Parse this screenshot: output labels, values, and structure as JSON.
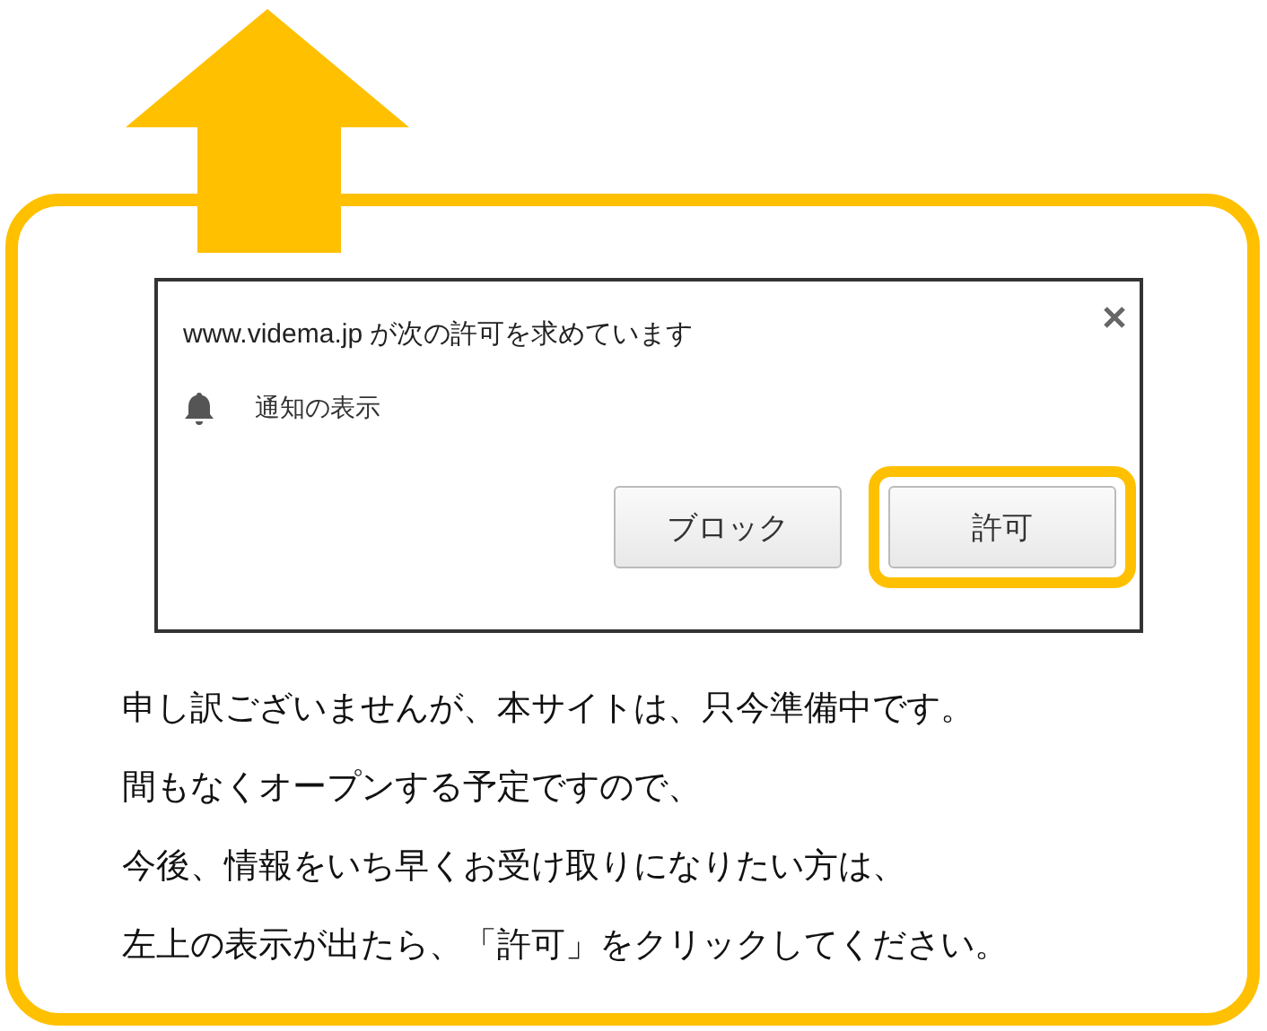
{
  "dialog": {
    "title": "www.videma.jp が次の許可を求めています",
    "permission": "通知の表示",
    "buttons": [
      {
        "label": "ブロック",
        "highlighted": false
      },
      {
        "label": "許可",
        "highlighted": true
      }
    ]
  },
  "notice_lines": [
    "申し訳ございませんが、本サイトは、只今準備中です。",
    "間もなくオープンする予定ですので、",
    "今後、情報をいち早くお受け取りになりたい方は、",
    "左上の表示が出たら、「許可」をクリックしてください。"
  ]
}
